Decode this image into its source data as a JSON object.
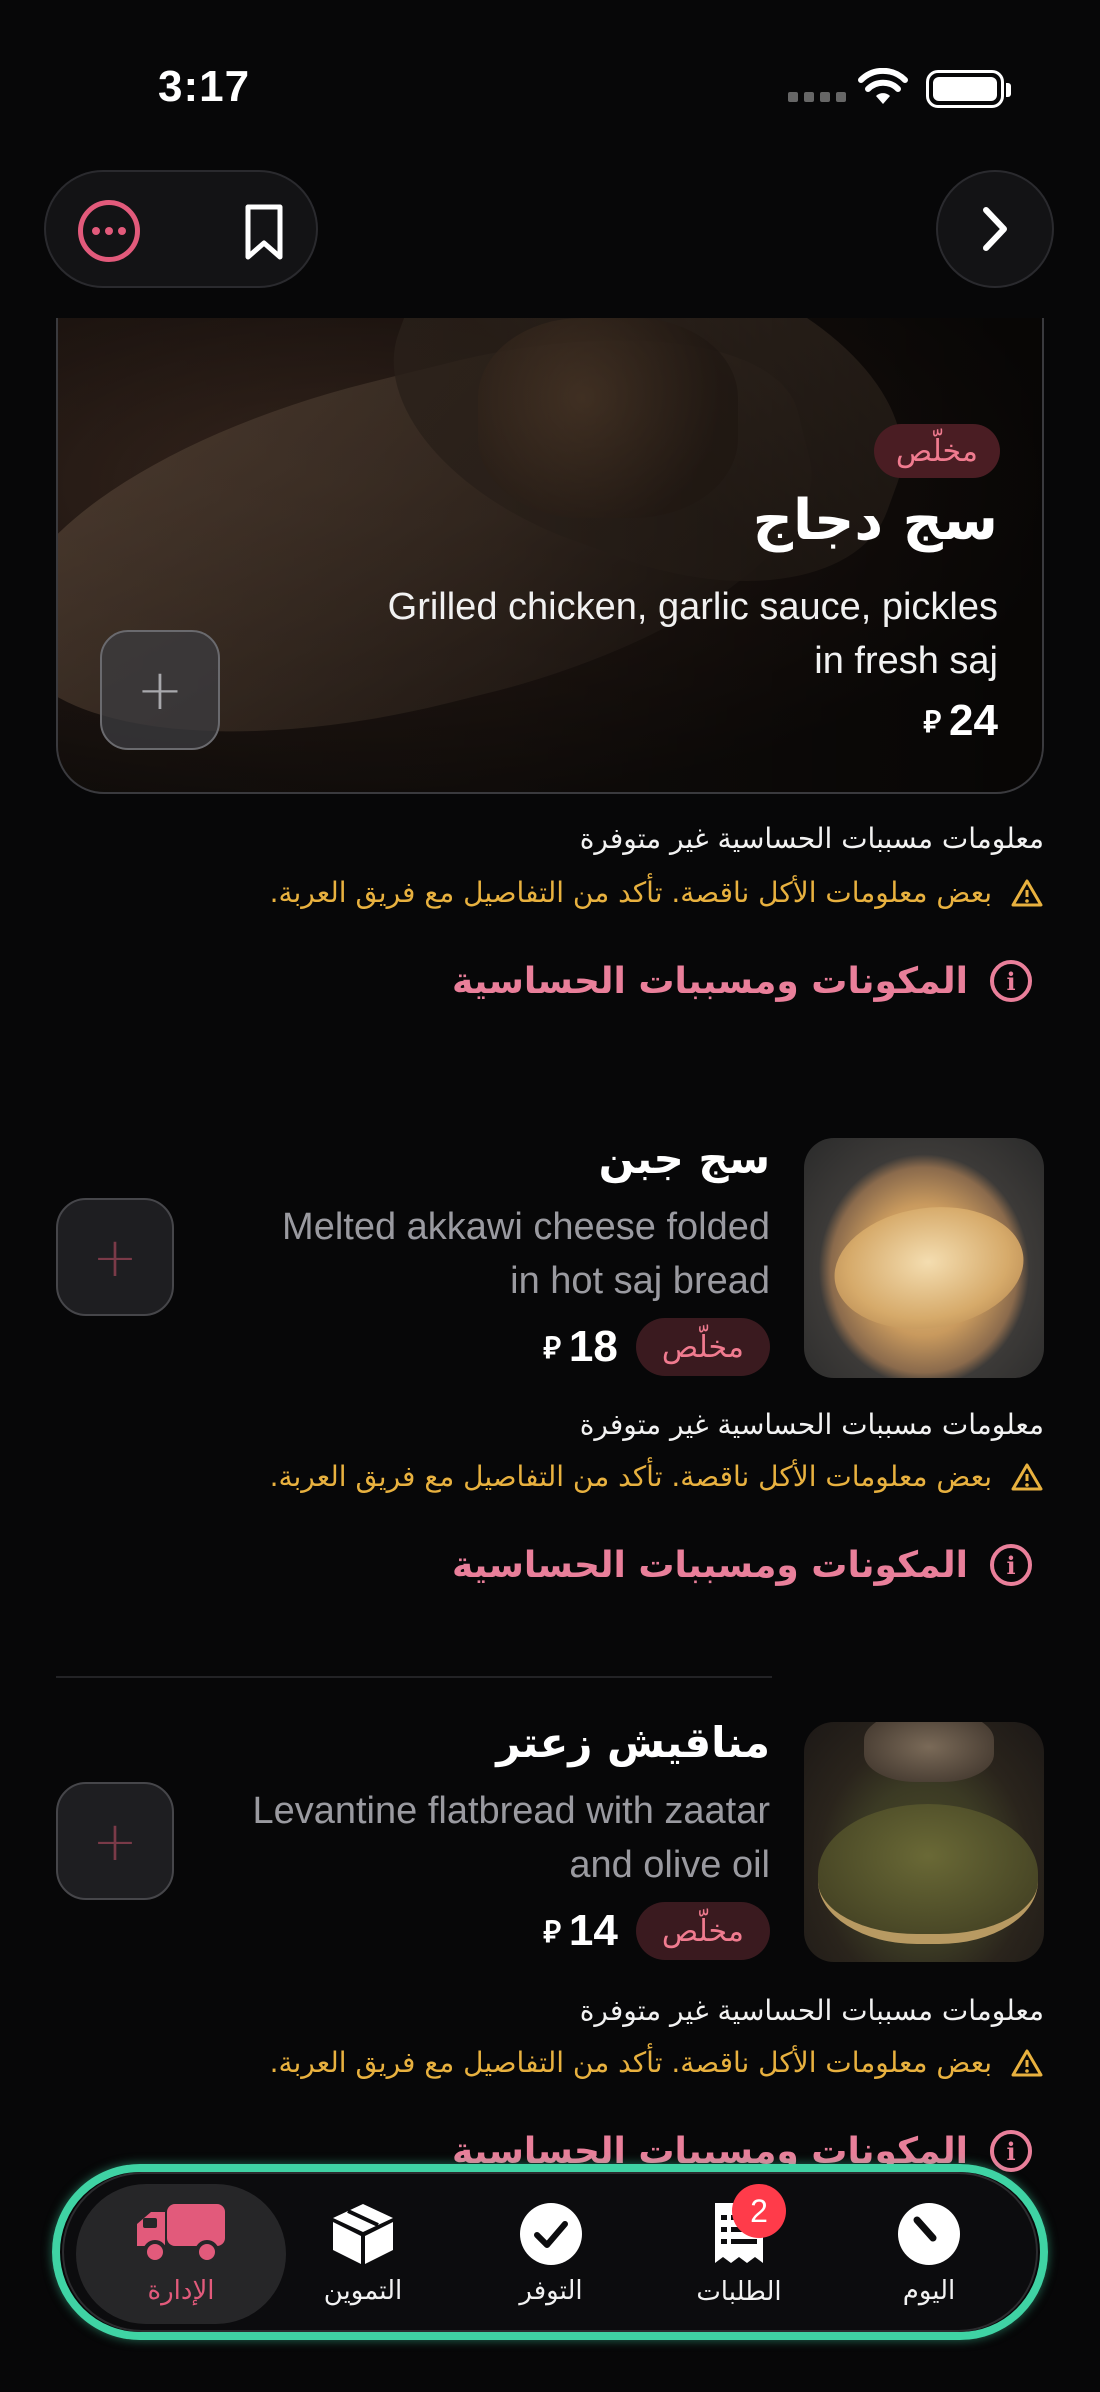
{
  "status_bar": {
    "time": "3:17"
  },
  "top_bar": {
    "icons": [
      "more-icon",
      "bookmark-icon",
      "chevron-right-icon"
    ]
  },
  "featured_item": {
    "tag": "مخلّص",
    "title": "سج دجاج",
    "description": "Grilled chicken, garlic sauce, pickles in fresh saj",
    "price": "24",
    "currency_symbol": "⃁",
    "add_label": "+"
  },
  "notices": {
    "allergen_title": "معلومات مسببات الحساسية غير متوفرة",
    "allergen_warning": "بعض معلومات الأكل ناقصة. تأكد من التفاصيل مع فريق العربة.",
    "ingredients_link": "المكونات ومسببات الحساسية"
  },
  "items": [
    {
      "title": "سج جبن",
      "description": "Melted akkawi cheese folded in hot saj bread",
      "price": "18",
      "tag": "مخلّص",
      "add_label": "+"
    },
    {
      "title": "مناقيش زعتر",
      "description": "Levantine flatbread with zaatar and olive oil",
      "price": "14",
      "tag": "مخلّص",
      "add_label": "+"
    }
  ],
  "tabbar": {
    "tabs": [
      {
        "label": "الإدارة",
        "icon": "truck-icon",
        "active": true
      },
      {
        "label": "التموين",
        "icon": "box-icon"
      },
      {
        "label": "التوفر",
        "icon": "check-circle-icon"
      },
      {
        "label": "الطلبات",
        "icon": "receipt-icon",
        "badge": "2"
      },
      {
        "label": "اليوم",
        "icon": "gauge-icon"
      }
    ]
  },
  "colors": {
    "accent": "#e25a7b",
    "warning": "#e8b13f",
    "tab_glow": "#3fd3a4",
    "background": "#070708"
  }
}
